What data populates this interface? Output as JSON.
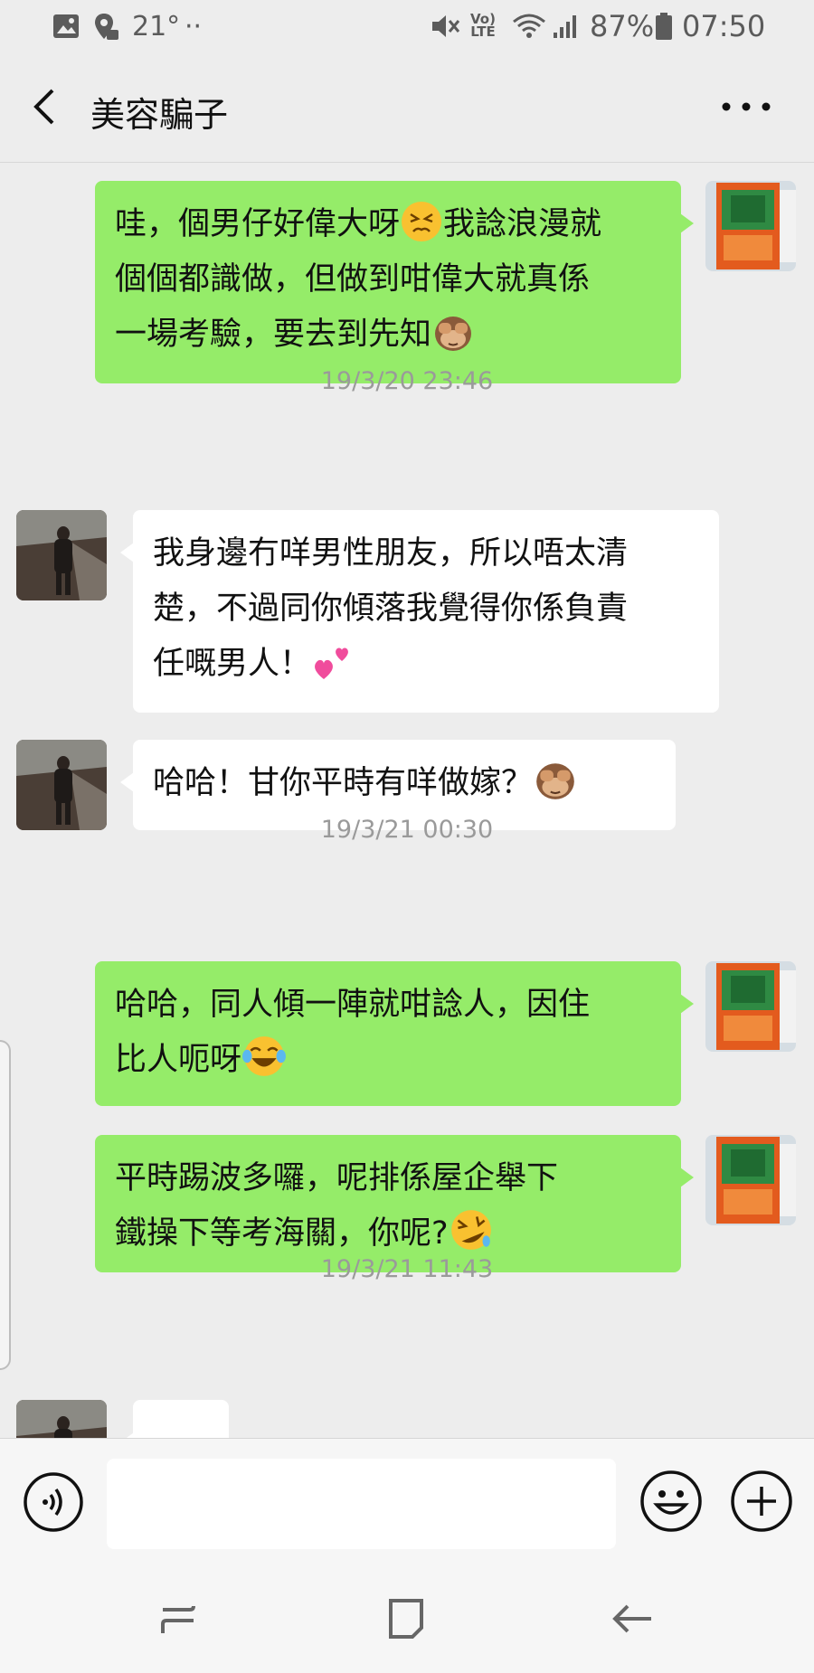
{
  "status_bar": {
    "temperature": "21°",
    "dots": "··",
    "network_label_top": "Vo)",
    "network_label_bottom": "LTE",
    "battery": "87%",
    "time": "07:50"
  },
  "header": {
    "title": "美容騙子"
  },
  "messages": [
    {
      "id": "m1",
      "side": "me",
      "lines": [
        "哇，個男仔好偉大呀",
        "我諗浪漫就",
        "個個都識做，但做到咁偉大就真係",
        "一場考驗，要去到先知"
      ],
      "emojis": [
        "persevering-face",
        "see-no-evil-monkey"
      ]
    },
    {
      "id": "t1",
      "timestamp": "19/3/20 23:46"
    },
    {
      "id": "m2",
      "side": "them",
      "lines": [
        " 我身邊冇咩男性朋友，所以唔太清",
        "楚，不過同你傾落我覺得你係負責",
        "任嘅男人！"
      ],
      "emojis": [
        "two-hearts"
      ]
    },
    {
      "id": "m3",
      "side": "them",
      "lines": [
        "哈哈！甘你平時有咩做嫁？"
      ],
      "emojis": [
        "see-no-evil-monkey"
      ]
    },
    {
      "id": "t2",
      "timestamp": "19/3/21 00:30"
    },
    {
      "id": "m4",
      "side": "me",
      "lines": [
        "哈哈，同人傾一陣就咁諗人，因住",
        "比人呃呀"
      ],
      "emojis": [
        "tears-of-joy"
      ]
    },
    {
      "id": "m5",
      "side": "me",
      "lines": [
        "平時踢波多囉，呢排係屋企舉下",
        "鐵操下等考海關，你呢?"
      ],
      "emojis": [
        "rolling-laughing"
      ]
    },
    {
      "id": "t3",
      "timestamp": "19/3/21 11:43"
    },
    {
      "id": "m6",
      "side": "them",
      "lines": [
        "?["
      ],
      "partial": true
    }
  ],
  "input": {
    "value": "",
    "placeholder": ""
  },
  "colors": {
    "my_bubble": "#95ec69",
    "their_bubble": "#ffffff",
    "background": "#ededed",
    "timestamp_text": "#9a9a9a"
  },
  "icons": {
    "back": "chevron-left-icon",
    "more": "more-dots-icon",
    "voice": "voice-icon",
    "emoji": "emoji-face-icon",
    "plus": "plus-icon"
  }
}
